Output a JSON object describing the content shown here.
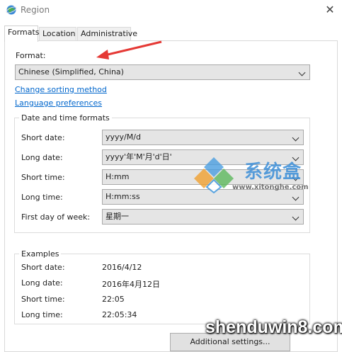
{
  "window": {
    "title": "Region",
    "close_glyph": "✕",
    "app_icon": "globe-icon"
  },
  "tabs": [
    {
      "label": "Formats",
      "active": true
    },
    {
      "label": "Location",
      "active": false
    },
    {
      "label": "Administrative",
      "active": false
    }
  ],
  "formats": {
    "format_label": "Format:",
    "format_value": "Chinese (Simplified, China)",
    "change_sorting_link": "Change sorting method",
    "language_prefs_link": "Language preferences"
  },
  "date_time": {
    "group_title": "Date and time formats",
    "rows": [
      {
        "label": "Short date:",
        "value": "yyyy/M/d"
      },
      {
        "label": "Long date:",
        "value": "yyyy'年'M'月'd'日'"
      },
      {
        "label": "Short time:",
        "value": "H:mm"
      },
      {
        "label": "Long time:",
        "value": "H:mm:ss"
      },
      {
        "label": "First day of week:",
        "value": "星期一"
      }
    ]
  },
  "examples": {
    "group_title": "Examples",
    "rows": [
      {
        "label": "Short date:",
        "value": "2016/4/12"
      },
      {
        "label": "Long date:",
        "value": "2016年4月12日"
      },
      {
        "label": "Short time:",
        "value": "22:05"
      },
      {
        "label": "Long time:",
        "value": "22:05:34"
      }
    ]
  },
  "buttons": {
    "additional_settings": "Additional settings..."
  },
  "watermarks": {
    "site_cn": "系统盒",
    "site_url": "www.xitonghe.com",
    "bottom": "shenduwin8.com"
  },
  "colors": {
    "link": "#0066cc",
    "annotation_arrow": "#e53935"
  }
}
